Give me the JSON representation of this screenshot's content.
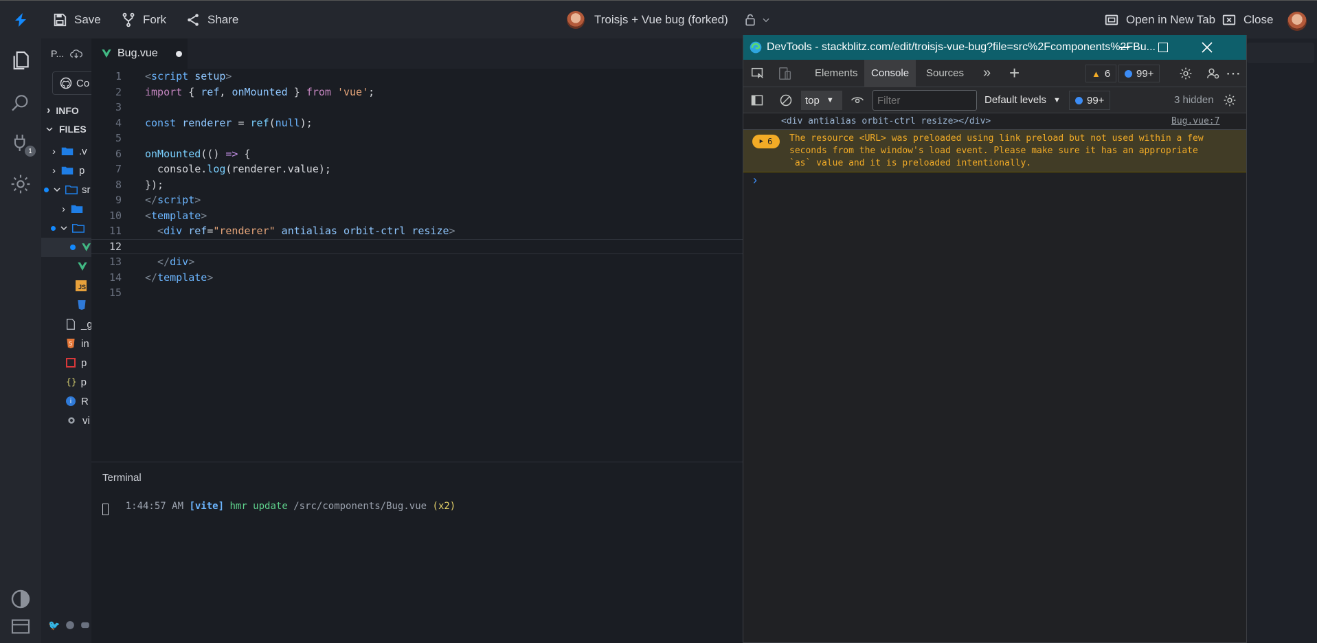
{
  "topbar": {
    "save_label": "Save",
    "fork_label": "Fork",
    "share_label": "Share",
    "project_title": "Troisjs + Vue bug (forked)",
    "open_new_tab_label": "Open in New Tab",
    "close_label": "Close"
  },
  "activity": {
    "extensions_badge": "1"
  },
  "sidebar": {
    "project_abbrev": "P...",
    "connect_label": "Co",
    "info_label": "INFO",
    "files_label": "FILES",
    "items": [
      {
        "label": ".v"
      },
      {
        "label": "p"
      },
      {
        "label": "sr"
      },
      {
        "label": ""
      },
      {
        "label": ""
      },
      {
        "label": ""
      },
      {
        "label": ""
      },
      {
        "label": ""
      },
      {
        "label": "_g"
      },
      {
        "label": "in"
      },
      {
        "label": "p"
      },
      {
        "label": "p"
      },
      {
        "label": "R"
      },
      {
        "label": "vi"
      }
    ]
  },
  "editor": {
    "tab_label": "Bug.vue",
    "lines": [
      {
        "n": "1"
      },
      {
        "n": "2"
      },
      {
        "n": "3"
      },
      {
        "n": "4"
      },
      {
        "n": "5"
      },
      {
        "n": "6"
      },
      {
        "n": "7"
      },
      {
        "n": "8"
      },
      {
        "n": "9"
      },
      {
        "n": "10"
      },
      {
        "n": "11"
      },
      {
        "n": "12"
      },
      {
        "n": "13"
      },
      {
        "n": "14"
      },
      {
        "n": "15"
      }
    ],
    "code": {
      "l1a": "<",
      "l1b": "script",
      "l1c": " setup",
      "l1d": ">",
      "l2a": "import",
      "l2b": " { ",
      "l2c": "ref",
      "l2d": ", ",
      "l2e": "onMounted",
      "l2f": " } ",
      "l2g": "from",
      "l2h": " ",
      "l2i": "'vue'",
      "l2j": ";",
      "l4a": "const",
      "l4b": " ",
      "l4c": "renderer",
      "l4d": " = ",
      "l4e": "ref",
      "l4f": "(",
      "l4g": "null",
      "l4h": ");",
      "l6a": "onMounted",
      "l6b": "(() ",
      "l6c": "=>",
      "l6d": " {",
      "l7a": "  console.",
      "l7b": "log",
      "l7c": "(renderer.value);",
      "l8a": "});",
      "l9a": "</",
      "l9b": "script",
      "l9c": ">",
      "l10a": "<",
      "l10b": "template",
      "l10c": ">",
      "l11a": "  <",
      "l11b": "div",
      "l11c": " ref",
      "l11d": "=",
      "l11e": "\"renderer\"",
      "l11f": " antialias orbit-ctrl resize",
      "l11g": ">",
      "l13a": "  </",
      "l13b": "div",
      "l13c": ">",
      "l14a": "</",
      "l14b": "template",
      "l14c": ">"
    }
  },
  "terminal": {
    "title": "Terminal",
    "time": "1:44:57 AM",
    "tag": "[vite]",
    "action": "hmr update",
    "path": "/src/components/Bug.vue",
    "count": "(x2)"
  },
  "devtools": {
    "window_title": "DevTools - stackblitz.com/edit/troisjs-vue-bug?file=src%2Fcomponents%2FBu...",
    "tabs": [
      "Elements",
      "Console",
      "Sources"
    ],
    "active_tab": "Console",
    "warnings_count": "6",
    "messages_count": "99+",
    "context": "top",
    "filter_placeholder": "Filter",
    "levels_label": "Default levels",
    "issues_count": "99+",
    "hidden_label": "3 hidden",
    "log_text": "<div antialias orbit-ctrl resize></div>",
    "log_source": "Bug.vue:7",
    "warning_repeat": "6",
    "warning_text_1": "The resource <URL> was preloaded using link preload but not used within a few",
    "warning_text_2": "seconds from the window's load event. Please make sure it has an appropriate",
    "warning_text_3": "`as` value and it is preloaded intentionally.",
    "prompt": "›"
  },
  "colors": {
    "accent": "#1389fd",
    "devtools_titlebar": "#0e5f6b",
    "warning_bg": "#413c26",
    "warning_text": "#f2ab26"
  }
}
